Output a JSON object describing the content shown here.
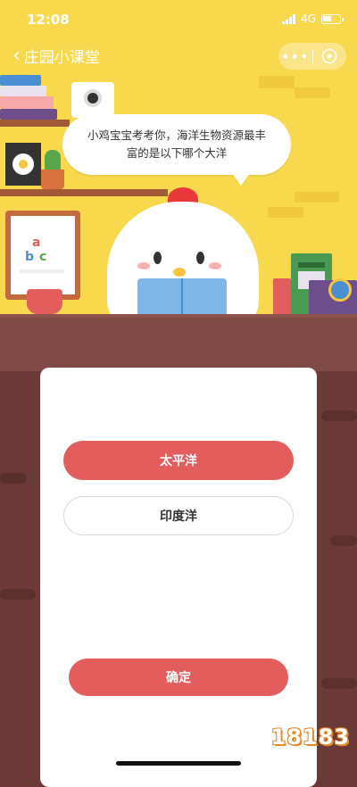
{
  "status": {
    "time": "12:08",
    "network": "4G"
  },
  "nav": {
    "back_label": "庄园小课堂"
  },
  "question": {
    "text": "小鸡宝宝考考你，海洋生物资源最丰富的是以下哪个大洋"
  },
  "options": [
    {
      "label": "太平洋",
      "state": "selected"
    },
    {
      "label": "印度洋",
      "state": "unselected"
    }
  ],
  "confirm_label": "确定",
  "watermark": "18183",
  "colors": {
    "scene_bg": "#f8d84d",
    "accent": "#e35d5d",
    "wood": "#7e4a43"
  }
}
